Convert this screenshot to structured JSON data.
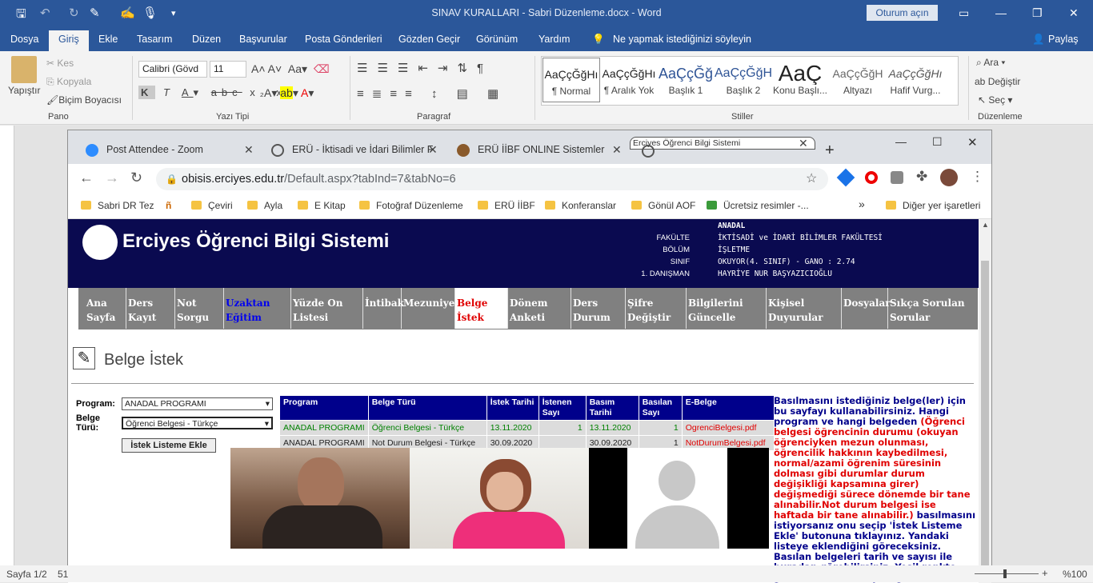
{
  "word": {
    "title": "SINAV KURALLARI - Sabri Düzenleme.docx  -  Word",
    "signin": "Oturum açın",
    "menu": [
      "Dosya",
      "Giriş",
      "Ekle",
      "Tasarım",
      "Düzen",
      "Başvurular",
      "Posta Gönderileri",
      "Gözden Geçir",
      "Görünüm",
      "Yardım"
    ],
    "tellme": "Ne yapmak istediğinizi söyleyin",
    "share": "Paylaş",
    "clipboard": {
      "paste": "Yapıştır",
      "cut": "Kes",
      "copy": "Kopyala",
      "painter": "Biçim Boyacısı",
      "group": "Pano"
    },
    "font": {
      "name": "Calibri (Gövd",
      "size": "11",
      "group": "Yazı Tipi"
    },
    "paragraph_group": "Paragraf",
    "styles": [
      {
        "preview": "AaÇçĞğHı",
        "name": "¶ Normal"
      },
      {
        "preview": "AaÇçĞğHı",
        "name": "¶ Aralık Yok"
      },
      {
        "preview": "AaÇçĞğ",
        "name": "Başlık 1"
      },
      {
        "preview": "AaÇçĞğH",
        "name": "Başlık 2"
      },
      {
        "preview": "AaÇ",
        "name": "Konu Başlı..."
      },
      {
        "preview": "AaÇçĞğH",
        "name": "Altyazı"
      },
      {
        "preview": "AaÇçĞğHı",
        "name": "Hafif Vurg..."
      }
    ],
    "styles_group": "Stiller",
    "editing": {
      "find": "Ara",
      "replace": "Değiştir",
      "select": "Seç",
      "group": "Düzenleme"
    },
    "status": {
      "page": "Sayfa 1/2",
      "words": "51",
      "zoom": "%100"
    }
  },
  "browser": {
    "tabs": [
      "Post Attendee - Zoom",
      "ERÜ - İktisadi ve İdari Bilimler F",
      "ERÜ İİBF ONLINE Sistemler",
      "Erciyes Öğrenci Bilgi Sistemi"
    ],
    "url_host": "obisis.erciyes.edu.tr",
    "url_path": "/Default.aspx?tabInd=7&tabNo=6",
    "bookmarks": [
      "Sabri DR Tez",
      "Çeviri",
      "Ayla",
      "E Kitap",
      "Fotoğraf Düzenleme",
      "ERÜ İİBF",
      "Konferanslar",
      "Gönül AOF",
      "Ücretsiz resimler -...",
      "Diğer yer işaretleri"
    ]
  },
  "site": {
    "name": "Erciyes Öğrenci Bilgi Sistemi",
    "program_type": "ANADAL",
    "labels": [
      "FAKÜLTE",
      "BÖLÜM",
      "SINIF",
      "1. DANIŞMAN"
    ],
    "values": [
      "İKTİSADİ ve İDARİ BİLİMLER FAKÜLTESİ",
      "İŞLETME",
      "OKUYOR(4. SINIF) - GANO : 2.74",
      "HAYRİYE NUR BAŞYAZICIOĞLU"
    ],
    "nav": [
      "Ana Sayfa",
      "Ders Kayıt",
      "Not Sorgu",
      "Uzaktan Eğitim",
      "Yüzde On Listesi",
      "İntibak",
      "Mezuniyet",
      "Belge İstek",
      "Dönem Anketi",
      "Ders Durum",
      "Şifre Değiştir",
      "Bilgilerini Güncelle",
      "Kişisel Duyurular",
      "Dosyalar",
      "Sıkça Sorulan Sorular"
    ],
    "page_title": "Belge İstek",
    "form": {
      "program_label": "Program:",
      "program_value": "ANADAL PROGRAMI",
      "type_label": "Belge Türü:",
      "type_value": "Öğrenci Belgesi - Türkçe",
      "button": "İstek Listeme Ekle"
    },
    "table": {
      "headers": [
        "Program",
        "Belge Türü",
        "İstek Tarihi",
        "İstenen Sayı",
        "Basım Tarihi",
        "Basılan Sayı",
        "E-Belge"
      ],
      "rows": [
        [
          "ANADAL PROGRAMI",
          "Öğrenci Belgesi - Türkçe",
          "13.11.2020",
          "1",
          "13.11.2020",
          "1",
          "OgrenciBelgesi.pdf"
        ],
        [
          "ANADAL PROGRAMI",
          "Not Durum Belgesi - Türkçe",
          "30.09.2020",
          "",
          "30.09.2020",
          "1",
          "NotDurumBelgesi.pdf"
        ]
      ]
    },
    "info": {
      "p1": "Basılmasını istediğiniz belge(ler) için bu sayfayı kullanabilirsiniz. Hangi program ve hangi belgeden",
      "red": "(Öğrenci belgesi öğrencinin durumu (okuyan öğrenciyken mezun olunması, öğrencilik hakkının kaybedilmesi, normal/azami öğrenim süresinin dolması gibi durumlar durum değişikliği kapsamına girer) değişmediği sürece dönemde bir tane alınabilir.Not durum belgesi ise haftada bir tane alınabilir.)",
      "p2": "basılmasını istiyorsanız onu seçip 'İstek Listeme Ekle' butonuna tıklayınız. Yandaki listeye eklendiğini göreceksiniz. Basılan belgeleri tarih ve sayısı ile buradan görebilirsiniz. Yeşil renkte görünenler basılmış belgelerdir. Basılan belgeler elektronik doğrulamalı"
    }
  }
}
